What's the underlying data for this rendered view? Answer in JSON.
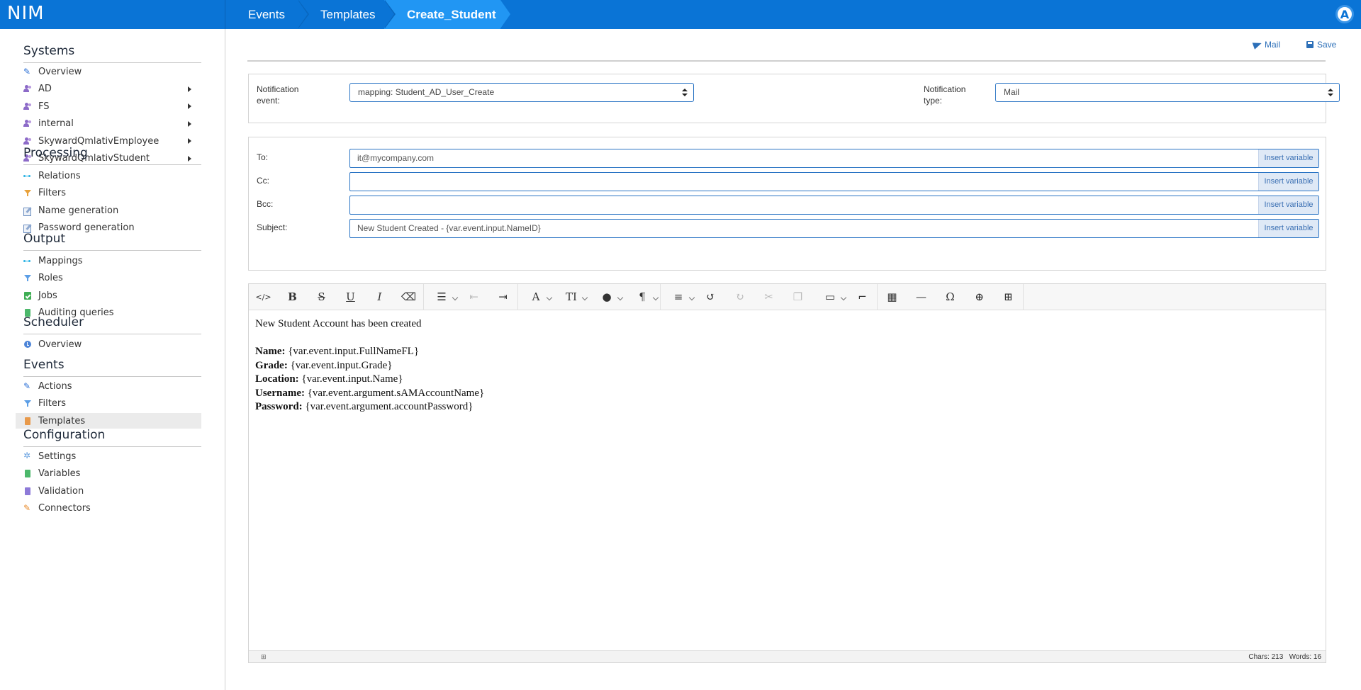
{
  "app": {
    "logo": "NIM",
    "avatar_letter": "A"
  },
  "breadcrumb": [
    {
      "label": "Events"
    },
    {
      "label": "Templates"
    },
    {
      "label": "Create_Student"
    }
  ],
  "sidebar": {
    "sections": [
      {
        "title": "Systems",
        "items": [
          {
            "label": "Overview",
            "icon": "wrench-icon"
          },
          {
            "label": "AD",
            "icon": "users-icon",
            "expandable": true
          },
          {
            "label": "FS",
            "icon": "users-icon",
            "expandable": true
          },
          {
            "label": "internal",
            "icon": "users-icon",
            "expandable": true
          },
          {
            "label": "SkywardQmlativEmployee",
            "icon": "users-icon",
            "expandable": true
          },
          {
            "label": "SkywardQmlativStudent",
            "icon": "users-icon",
            "expandable": true
          }
        ]
      },
      {
        "title": "Processing",
        "items": [
          {
            "label": "Relations",
            "icon": "relations-icon"
          },
          {
            "label": "Filters",
            "icon": "filter-icon"
          },
          {
            "label": "Name generation",
            "icon": "edit-icon"
          },
          {
            "label": "Password generation",
            "icon": "edit-icon"
          }
        ]
      },
      {
        "title": "Output",
        "items": [
          {
            "label": "Mappings",
            "icon": "mappings-icon"
          },
          {
            "label": "Roles",
            "icon": "filter-icon"
          },
          {
            "label": "Jobs",
            "icon": "jobs-icon"
          },
          {
            "label": "Auditing queries",
            "icon": "document-icon"
          }
        ]
      },
      {
        "title": "Scheduler",
        "items": [
          {
            "label": "Overview",
            "icon": "clock-icon"
          }
        ]
      },
      {
        "title": "Events",
        "items": [
          {
            "label": "Actions",
            "icon": "wrench-icon"
          },
          {
            "label": "Filters",
            "icon": "filter-icon"
          },
          {
            "label": "Templates",
            "icon": "template-icon",
            "selected": true
          }
        ]
      },
      {
        "title": "Configuration",
        "items": [
          {
            "label": "Settings",
            "icon": "gear-icon"
          },
          {
            "label": "Variables",
            "icon": "document-icon"
          },
          {
            "label": "Validation",
            "icon": "validation-icon"
          },
          {
            "label": "Connectors",
            "icon": "wrench-icon"
          }
        ]
      }
    ]
  },
  "actions": {
    "mail_label": "Mail",
    "save_label": "Save"
  },
  "notification": {
    "event_label": "Notification\nevent:",
    "event_value": "mapping: Student_AD_User_Create",
    "type_label": "Notification\ntype:",
    "type_value": "Mail"
  },
  "fields": [
    {
      "label": "To:",
      "value": "it@mycompany.com",
      "button": "Insert variable"
    },
    {
      "label": "Cc:",
      "value": "",
      "button": "Insert variable"
    },
    {
      "label": "Bcc:",
      "value": "",
      "button": "Insert variable"
    },
    {
      "label": "Subject:",
      "value": "New Student Created - {var.event.input.NameID}",
      "button": "Insert variable"
    }
  ],
  "editor": {
    "toolbar": [
      {
        "name": "code-view-button",
        "glyph": "</>"
      },
      {
        "name": "bold-button",
        "glyph": "B"
      },
      {
        "name": "strikethrough-button",
        "glyph": "S"
      },
      {
        "name": "underline-button",
        "glyph": "U"
      },
      {
        "name": "italic-button",
        "glyph": "I"
      },
      {
        "name": "clear-format-button",
        "glyph": "⌫"
      },
      {
        "name": "list-button",
        "glyph": "☰",
        "dropdown": true
      },
      {
        "name": "outdent-button",
        "glyph": "⇤",
        "disabled": true
      },
      {
        "name": "indent-button",
        "glyph": "⇥"
      },
      {
        "name": "font-button",
        "glyph": "A",
        "dropdown": true
      },
      {
        "name": "font-size-button",
        "glyph": "TI",
        "dropdown": true
      },
      {
        "name": "color-button",
        "glyph": "●",
        "dropdown": true
      },
      {
        "name": "paragraph-button",
        "glyph": "¶",
        "dropdown": true
      },
      {
        "name": "align-button",
        "glyph": "≡",
        "dropdown": true
      },
      {
        "name": "undo-button",
        "glyph": "↺"
      },
      {
        "name": "redo-button",
        "glyph": "↻",
        "disabled": true
      },
      {
        "name": "cut-button",
        "glyph": "✂",
        "disabled": true
      },
      {
        "name": "copy-button",
        "glyph": "❐",
        "disabled": true
      },
      {
        "name": "paste-button",
        "glyph": "▭",
        "dropdown": true
      },
      {
        "name": "format-painter-button",
        "glyph": "⌐"
      },
      {
        "name": "table-button",
        "glyph": "▦"
      },
      {
        "name": "horizontal-rule-button",
        "glyph": "—"
      },
      {
        "name": "special-char-button",
        "glyph": "Ω"
      },
      {
        "name": "insert-button",
        "glyph": "⊕"
      },
      {
        "name": "select-all-button",
        "glyph": "⊞"
      }
    ],
    "content": [
      {
        "label": "",
        "text": "New Student Account has been created"
      },
      {
        "label": "",
        "text": ""
      },
      {
        "label": "Name:",
        "text": " {var.event.input.FullNameFL}"
      },
      {
        "label": "Grade:",
        "text": " {var.event.input.Grade}"
      },
      {
        "label": "Location:",
        "text": " {var.event.input.Name}"
      },
      {
        "label": "Username:",
        "text": " {var.event.argument.sAMAccountName}"
      },
      {
        "label": "Password:",
        "text": " {var.event.argument.accountPassword}"
      }
    ],
    "status": {
      "chars": "Chars: 213",
      "words": "Words: 16"
    }
  }
}
